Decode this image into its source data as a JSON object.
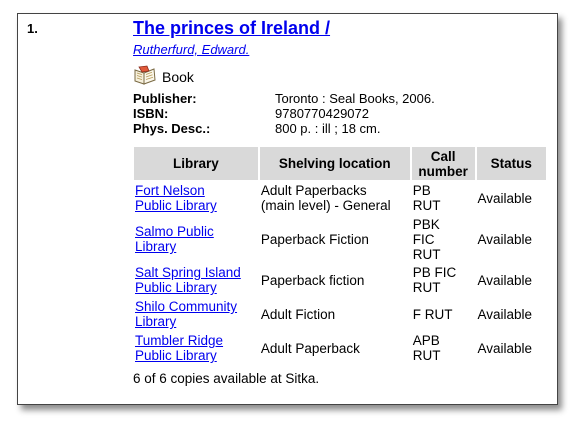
{
  "record": {
    "number": "1.",
    "title": "The princes of Ireland /",
    "author": "Rutherfurd, Edward.",
    "format_icon": "book-icon",
    "format": "Book",
    "details": [
      {
        "label": "Publisher:",
        "value": "Toronto : Seal Books, 2006."
      },
      {
        "label": "ISBN:",
        "value": "9780770429072"
      },
      {
        "label": "Phys. Desc.:",
        "value": "800 p. : ill ; 18 cm."
      }
    ]
  },
  "copies_table": {
    "headers": {
      "library": "Library",
      "shelving": "Shelving location",
      "call_line1": "Call",
      "call_line2": "number",
      "status": "Status"
    },
    "rows": [
      {
        "lib1": "Fort Nelson",
        "lib2": "Public Library",
        "shelf1": "Adult Paperbacks",
        "shelf2": "(main level) - General",
        "call1": "PB",
        "call2": "RUT",
        "call3": "",
        "status": "Available"
      },
      {
        "lib1": "Salmo Public",
        "lib2": "Library",
        "shelf1": "Paperback Fiction",
        "shelf2": "",
        "call1": "PBK",
        "call2": "FIC",
        "call3": "RUT",
        "status": "Available"
      },
      {
        "lib1": "Salt Spring Island",
        "lib2": "Public Library",
        "shelf1": "Paperback fiction",
        "shelf2": "",
        "call1": "PB FIC",
        "call2": "RUT",
        "call3": "",
        "status": "Available"
      },
      {
        "lib1": "Shilo Community",
        "lib2": "Library",
        "shelf1": "Adult Fiction",
        "shelf2": "",
        "call1": "F RUT",
        "call2": "",
        "call3": "",
        "status": "Available"
      },
      {
        "lib1": "Tumbler Ridge",
        "lib2": "Public Library",
        "shelf1": "Adult Paperback",
        "shelf2": "",
        "call1": "APB",
        "call2": "RUT",
        "call3": "",
        "status": "Available"
      }
    ]
  },
  "summary": "6 of 6 copies available at Sitka.",
  "colors": {
    "link": "#0000ee",
    "header_bg": "#d9d9d9"
  }
}
